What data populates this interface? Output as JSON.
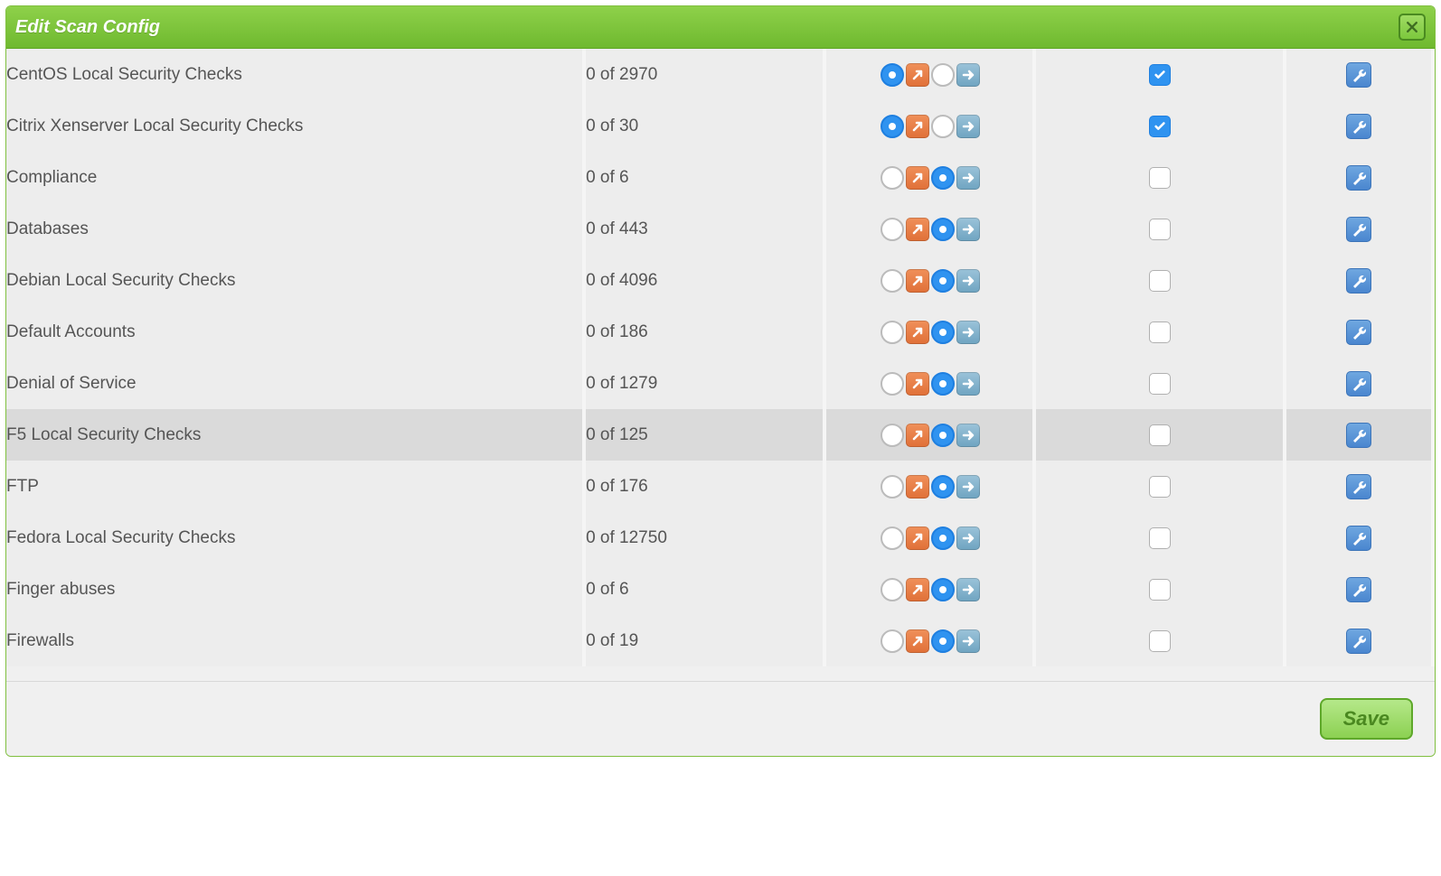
{
  "dialog": {
    "title": "Edit Scan Config",
    "save_label": "Save"
  },
  "rows": [
    {
      "name": "CentOS Local Security Checks",
      "count": "0 of 2970",
      "trend": 0,
      "checked": true
    },
    {
      "name": "Citrix Xenserver Local Security Checks",
      "count": "0 of 30",
      "trend": 0,
      "checked": true
    },
    {
      "name": "Compliance",
      "count": "0 of 6",
      "trend": 1,
      "checked": false
    },
    {
      "name": "Databases",
      "count": "0 of 443",
      "trend": 1,
      "checked": false
    },
    {
      "name": "Debian Local Security Checks",
      "count": "0 of 4096",
      "trend": 1,
      "checked": false
    },
    {
      "name": "Default Accounts",
      "count": "0 of 186",
      "trend": 1,
      "checked": false
    },
    {
      "name": "Denial of Service",
      "count": "0 of 1279",
      "trend": 1,
      "checked": false
    },
    {
      "name": "F5 Local Security Checks",
      "count": "0 of 125",
      "trend": 1,
      "checked": false,
      "hover": true
    },
    {
      "name": "FTP",
      "count": "0 of 176",
      "trend": 1,
      "checked": false
    },
    {
      "name": "Fedora Local Security Checks",
      "count": "0 of 12750",
      "trend": 1,
      "checked": false
    },
    {
      "name": "Finger abuses",
      "count": "0 of 6",
      "trend": 1,
      "checked": false
    },
    {
      "name": "Firewalls",
      "count": "0 of 19",
      "trend": 1,
      "checked": false
    }
  ]
}
